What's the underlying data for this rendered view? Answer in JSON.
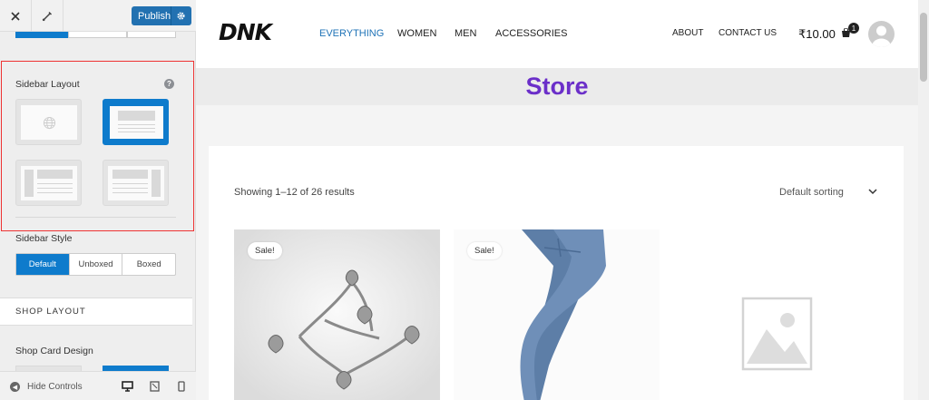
{
  "topbar": {
    "publish_label": "Publish"
  },
  "sidebar_layout": {
    "title": "Sidebar Layout",
    "help": "?",
    "options": [
      "full-width",
      "no-sidebar",
      "left-sidebar",
      "right-sidebar"
    ],
    "selected": "no-sidebar"
  },
  "sidebar_style": {
    "title": "Sidebar Style",
    "options": [
      "Default",
      "Unboxed",
      "Boxed"
    ],
    "selected": "Default"
  },
  "shop_layout": {
    "title": "SHOP LAYOUT"
  },
  "shop_card": {
    "title": "Shop Card Design"
  },
  "bottombar": {
    "hide_controls": "Hide Controls"
  },
  "site": {
    "logo": "DNK",
    "nav": [
      "EVERYTHING",
      "WOMEN",
      "MEN",
      "ACCESSORIES"
    ],
    "nav_active": "EVERYTHING",
    "secondary_nav": [
      "ABOUT",
      "CONTACT US"
    ],
    "cart_total": "₹10.00",
    "cart_count": "1"
  },
  "page": {
    "title": "Store"
  },
  "shop": {
    "results": "Showing 1–12 of 26 results",
    "sorting": "Default sorting",
    "products": [
      {
        "badge": "Sale!",
        "image": "bracelet"
      },
      {
        "badge": "Sale!",
        "image": "jeans"
      },
      {
        "badge": "",
        "image": "placeholder"
      }
    ]
  },
  "colors": {
    "accent": "#0e7bcc",
    "publish": "#2271b1",
    "title": "#6b2fc9",
    "nav_active": "#1f73b7",
    "highlight": "#e33333"
  }
}
